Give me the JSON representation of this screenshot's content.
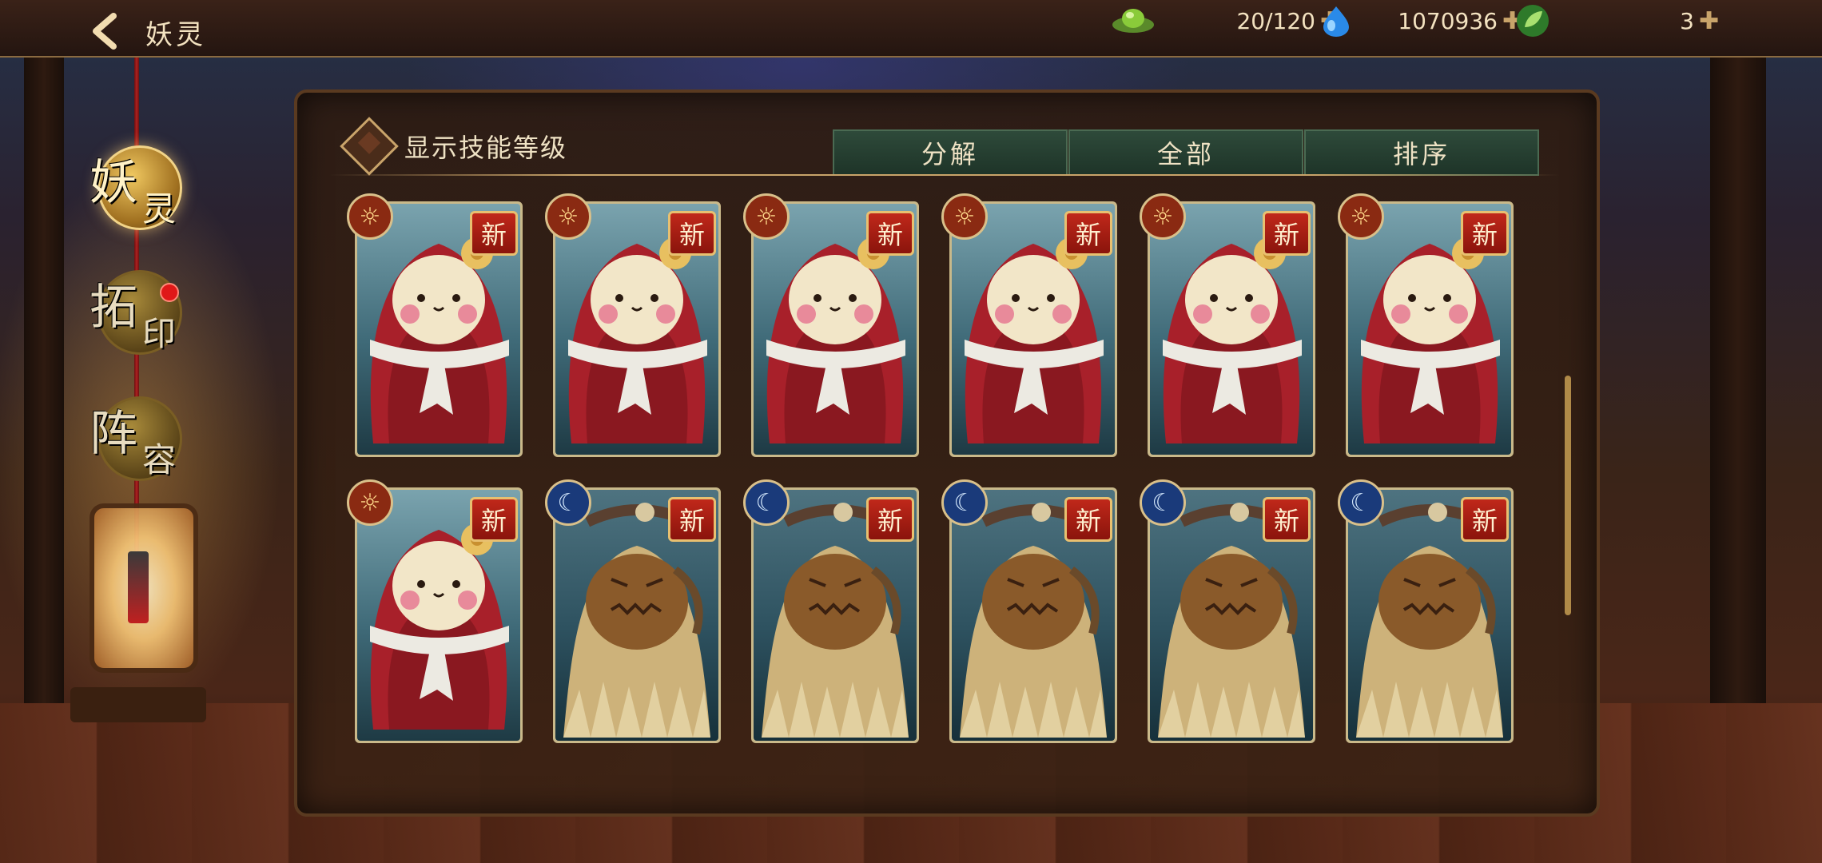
{
  "header": {
    "title": "妖灵",
    "resources": [
      {
        "icon": "jade-icon",
        "value": "20/120"
      },
      {
        "icon": "water-drop-icon",
        "value": "1070936"
      },
      {
        "icon": "leaf-orb-icon",
        "value": "3"
      }
    ],
    "plus_symbol": "✚"
  },
  "sidebar": {
    "items": [
      {
        "char1": "妖",
        "char2": "灵",
        "active": true
      },
      {
        "char1": "拓",
        "char2": "印",
        "active": false,
        "notification": true
      },
      {
        "char1": "阵",
        "char2": "容",
        "active": false
      }
    ]
  },
  "panel": {
    "toggle_label": "显示技能等级",
    "tabs": [
      "分解",
      "全部",
      "排序"
    ]
  },
  "cards": [
    {
      "character": "red-hood-doll",
      "attribute": "sun",
      "badge": "新"
    },
    {
      "character": "red-hood-doll",
      "attribute": "sun",
      "badge": "新"
    },
    {
      "character": "red-hood-doll",
      "attribute": "sun",
      "badge": "新"
    },
    {
      "character": "red-hood-doll",
      "attribute": "sun",
      "badge": "新"
    },
    {
      "character": "red-hood-doll",
      "attribute": "sun",
      "badge": "新"
    },
    {
      "character": "red-hood-doll",
      "attribute": "sun",
      "badge": "新"
    },
    {
      "character": "red-hood-doll",
      "attribute": "sun",
      "badge": "新"
    },
    {
      "character": "straw-scarecrow",
      "attribute": "moon",
      "badge": "新"
    },
    {
      "character": "straw-scarecrow",
      "attribute": "moon",
      "badge": "新"
    },
    {
      "character": "straw-scarecrow",
      "attribute": "moon",
      "badge": "新"
    },
    {
      "character": "straw-scarecrow",
      "attribute": "moon",
      "badge": "新"
    },
    {
      "character": "straw-scarecrow",
      "attribute": "moon",
      "badge": "新"
    }
  ],
  "colors": {
    "accent_gold": "#c9a46a",
    "tab_green": "#2e4a3a",
    "badge_red": "#c0281a"
  }
}
